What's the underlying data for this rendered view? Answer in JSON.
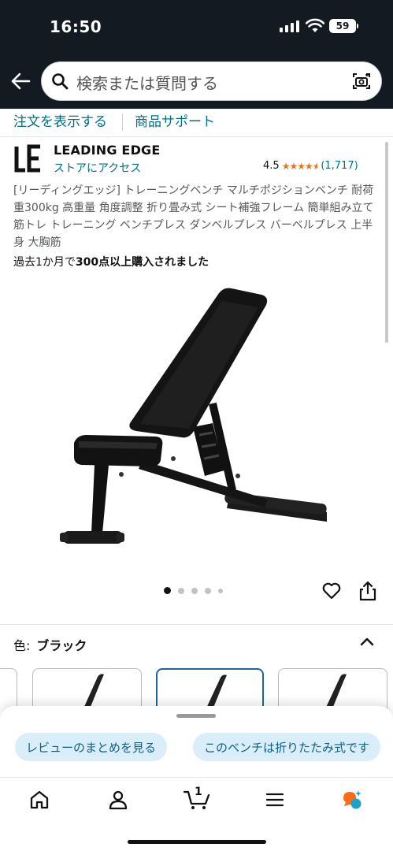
{
  "status_bar": {
    "time": "16:50",
    "battery": "59"
  },
  "search": {
    "placeholder": "検索または質問する"
  },
  "links": {
    "orders": "注文を表示する",
    "support": "商品サポート"
  },
  "brand": {
    "name": "LEADING EDGE",
    "store_link": "ストアにアクセス",
    "logo_letters": "LE"
  },
  "rating": {
    "value": "4.5",
    "stars": 4.5,
    "count": "(1,717)"
  },
  "product": {
    "title": "[リーディングエッジ] トレーニングベンチ マルチポジションベンチ 耐荷重300kg 高重量 角度調整 折り畳み式 シート補強フレーム 簡単組み立て 筋トレ トレーニング ベンチプレス ダンベルプレス バーベルプレス 上半身 大胸筋",
    "bought_prefix": "過去1か月で",
    "bought_bold": "300点以上購入されました"
  },
  "carousel": {
    "total": 5,
    "active": 1
  },
  "variant": {
    "label": "色:",
    "value": "ブラック"
  },
  "chips": [
    "レビューのまとめを見る",
    "このベンチは折りたたみ式です"
  ],
  "cart": {
    "count": "1"
  },
  "colors": {
    "header_bg": "#131a22",
    "link": "#007185",
    "star": "#de7921",
    "chip_bg": "#d9eef8",
    "selected_border": "#2162a1"
  }
}
